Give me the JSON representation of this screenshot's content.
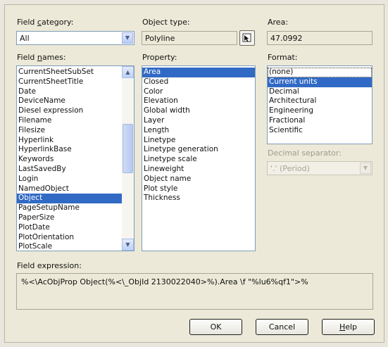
{
  "field_category": {
    "label_pre": "Field ",
    "label_u": "c",
    "label_post": "ategory:",
    "value": "All"
  },
  "object_type": {
    "label": "Object type:",
    "value": "Polyline"
  },
  "area": {
    "label": "Area:",
    "value": "47.0992"
  },
  "field_names": {
    "label_pre": "Field ",
    "label_u": "n",
    "label_post": "ames:",
    "items": [
      "CurrentSheetSubSet",
      "CurrentSheetTitle",
      "Date",
      "DeviceName",
      "Diesel expression",
      "Filename",
      "Filesize",
      "Hyperlink",
      "HyperlinkBase",
      "Keywords",
      "LastSavedBy",
      "Login",
      "NamedObject",
      "Object",
      "PageSetupName",
      "PaperSize",
      "PlotDate",
      "PlotOrientation",
      "PlotScale"
    ],
    "selected": "Object"
  },
  "property": {
    "label": "Property:",
    "items": [
      "Area",
      "Closed",
      "Color",
      "Elevation",
      "Global width",
      "Layer",
      "Length",
      "Linetype",
      "Linetype generation",
      "Linetype scale",
      "Lineweight",
      "Object name",
      "Plot style",
      "Thickness"
    ],
    "selected": "Area"
  },
  "format": {
    "label": "Format:",
    "items": [
      "(none)",
      "Current units",
      "Decimal",
      "Architectural",
      "Engineering",
      "Fractional",
      "Scientific"
    ],
    "selected": "Current units"
  },
  "decimal_separator": {
    "label": "Decimal separator:",
    "value": "'.' (Period)"
  },
  "field_expression": {
    "label": "Field expression:",
    "value": "%<\\AcObjProp Object(%<\\_ObjId 2130022040>%).Area \\f \"%lu6%qf1\">%"
  },
  "buttons": {
    "ok": "OK",
    "cancel": "Cancel",
    "help_u": "H",
    "help_post": "elp"
  },
  "colors": {
    "selection": "#316ac5",
    "dialog_bg": "#ece9d8"
  }
}
